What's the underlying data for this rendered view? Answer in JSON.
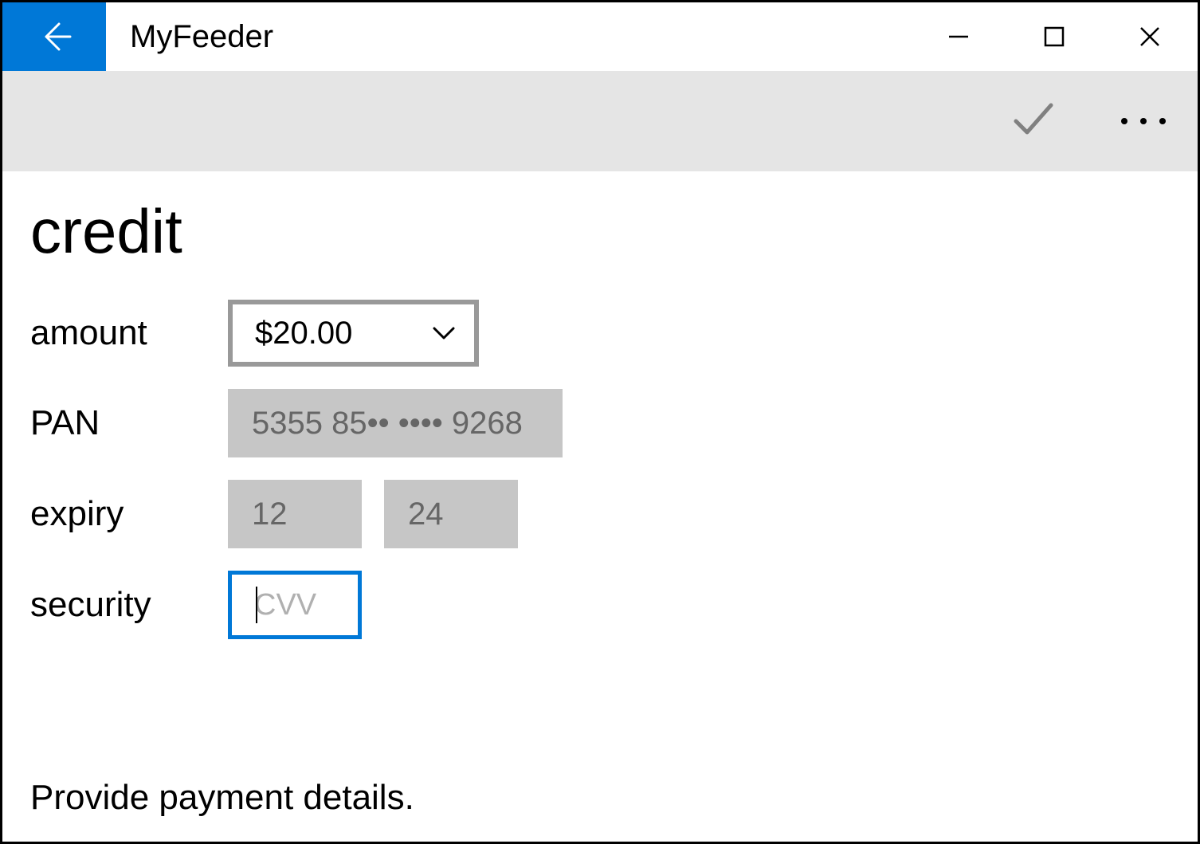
{
  "titlebar": {
    "app_name": "MyFeeder"
  },
  "page": {
    "title": "credit",
    "status": "Provide payment details."
  },
  "form": {
    "amount": {
      "label": "amount",
      "value": "$20.00"
    },
    "pan": {
      "label": "PAN",
      "value": "5355 85•• •••• 9268"
    },
    "expiry": {
      "label": "expiry",
      "month": "12",
      "year": "24"
    },
    "security": {
      "label": "security",
      "placeholder": "CVV",
      "value": ""
    }
  }
}
